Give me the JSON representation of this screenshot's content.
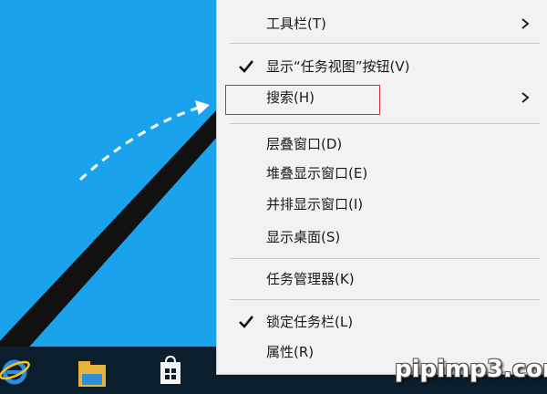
{
  "desktop": {
    "background_color": "#1aa3ec"
  },
  "taskbar": {
    "background_color": "#0b1e2e",
    "buttons": [
      {
        "name": "ie-icon"
      },
      {
        "name": "file-explorer-icon"
      },
      {
        "name": "store-icon"
      }
    ]
  },
  "context_menu": {
    "items": [
      {
        "label": "工具栏(T)",
        "checked": false,
        "has_submenu": true
      },
      {
        "label": "显示“任务视图”按钮(V)",
        "checked": true,
        "has_submenu": false
      },
      {
        "label": "搜索(H)",
        "checked": false,
        "has_submenu": true,
        "highlighted": true
      },
      {
        "label": "层叠窗口(D)",
        "checked": false,
        "has_submenu": false
      },
      {
        "label": "堆叠显示窗口(E)",
        "checked": false,
        "has_submenu": false
      },
      {
        "label": "并排显示窗口(I)",
        "checked": false,
        "has_submenu": false
      },
      {
        "label": "显示桌面(S)",
        "checked": false,
        "has_submenu": false
      },
      {
        "label": "任务管理器(K)",
        "checked": false,
        "has_submenu": false
      },
      {
        "label": "锁定任务栏(L)",
        "checked": true,
        "has_submenu": false
      },
      {
        "label": "属性(R)",
        "checked": false,
        "has_submenu": false
      }
    ],
    "highlight_color": "#d32f2f"
  },
  "watermark": {
    "text": "pipimp3.com"
  }
}
